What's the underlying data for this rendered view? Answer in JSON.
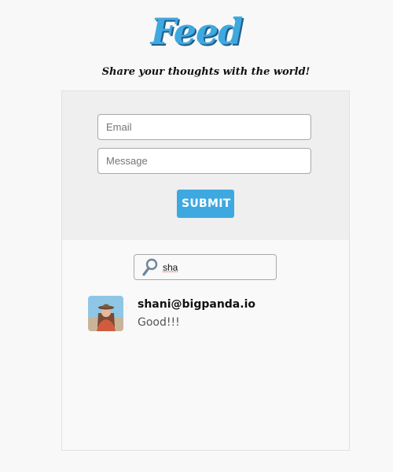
{
  "header": {
    "logo_text": "Feed",
    "tagline": "Share your thoughts with the world!"
  },
  "form": {
    "email_placeholder": "Email",
    "message_placeholder": "Message",
    "submit_label": "SUBMIT"
  },
  "search": {
    "value": "sha",
    "icon": "search-icon"
  },
  "posts": [
    {
      "email": "shani@bigpanda.io",
      "message": "Good!!!"
    }
  ],
  "colors": {
    "accent": "#3ea8e0",
    "form_background": "#efefef",
    "page_background": "#f8f8f8"
  }
}
